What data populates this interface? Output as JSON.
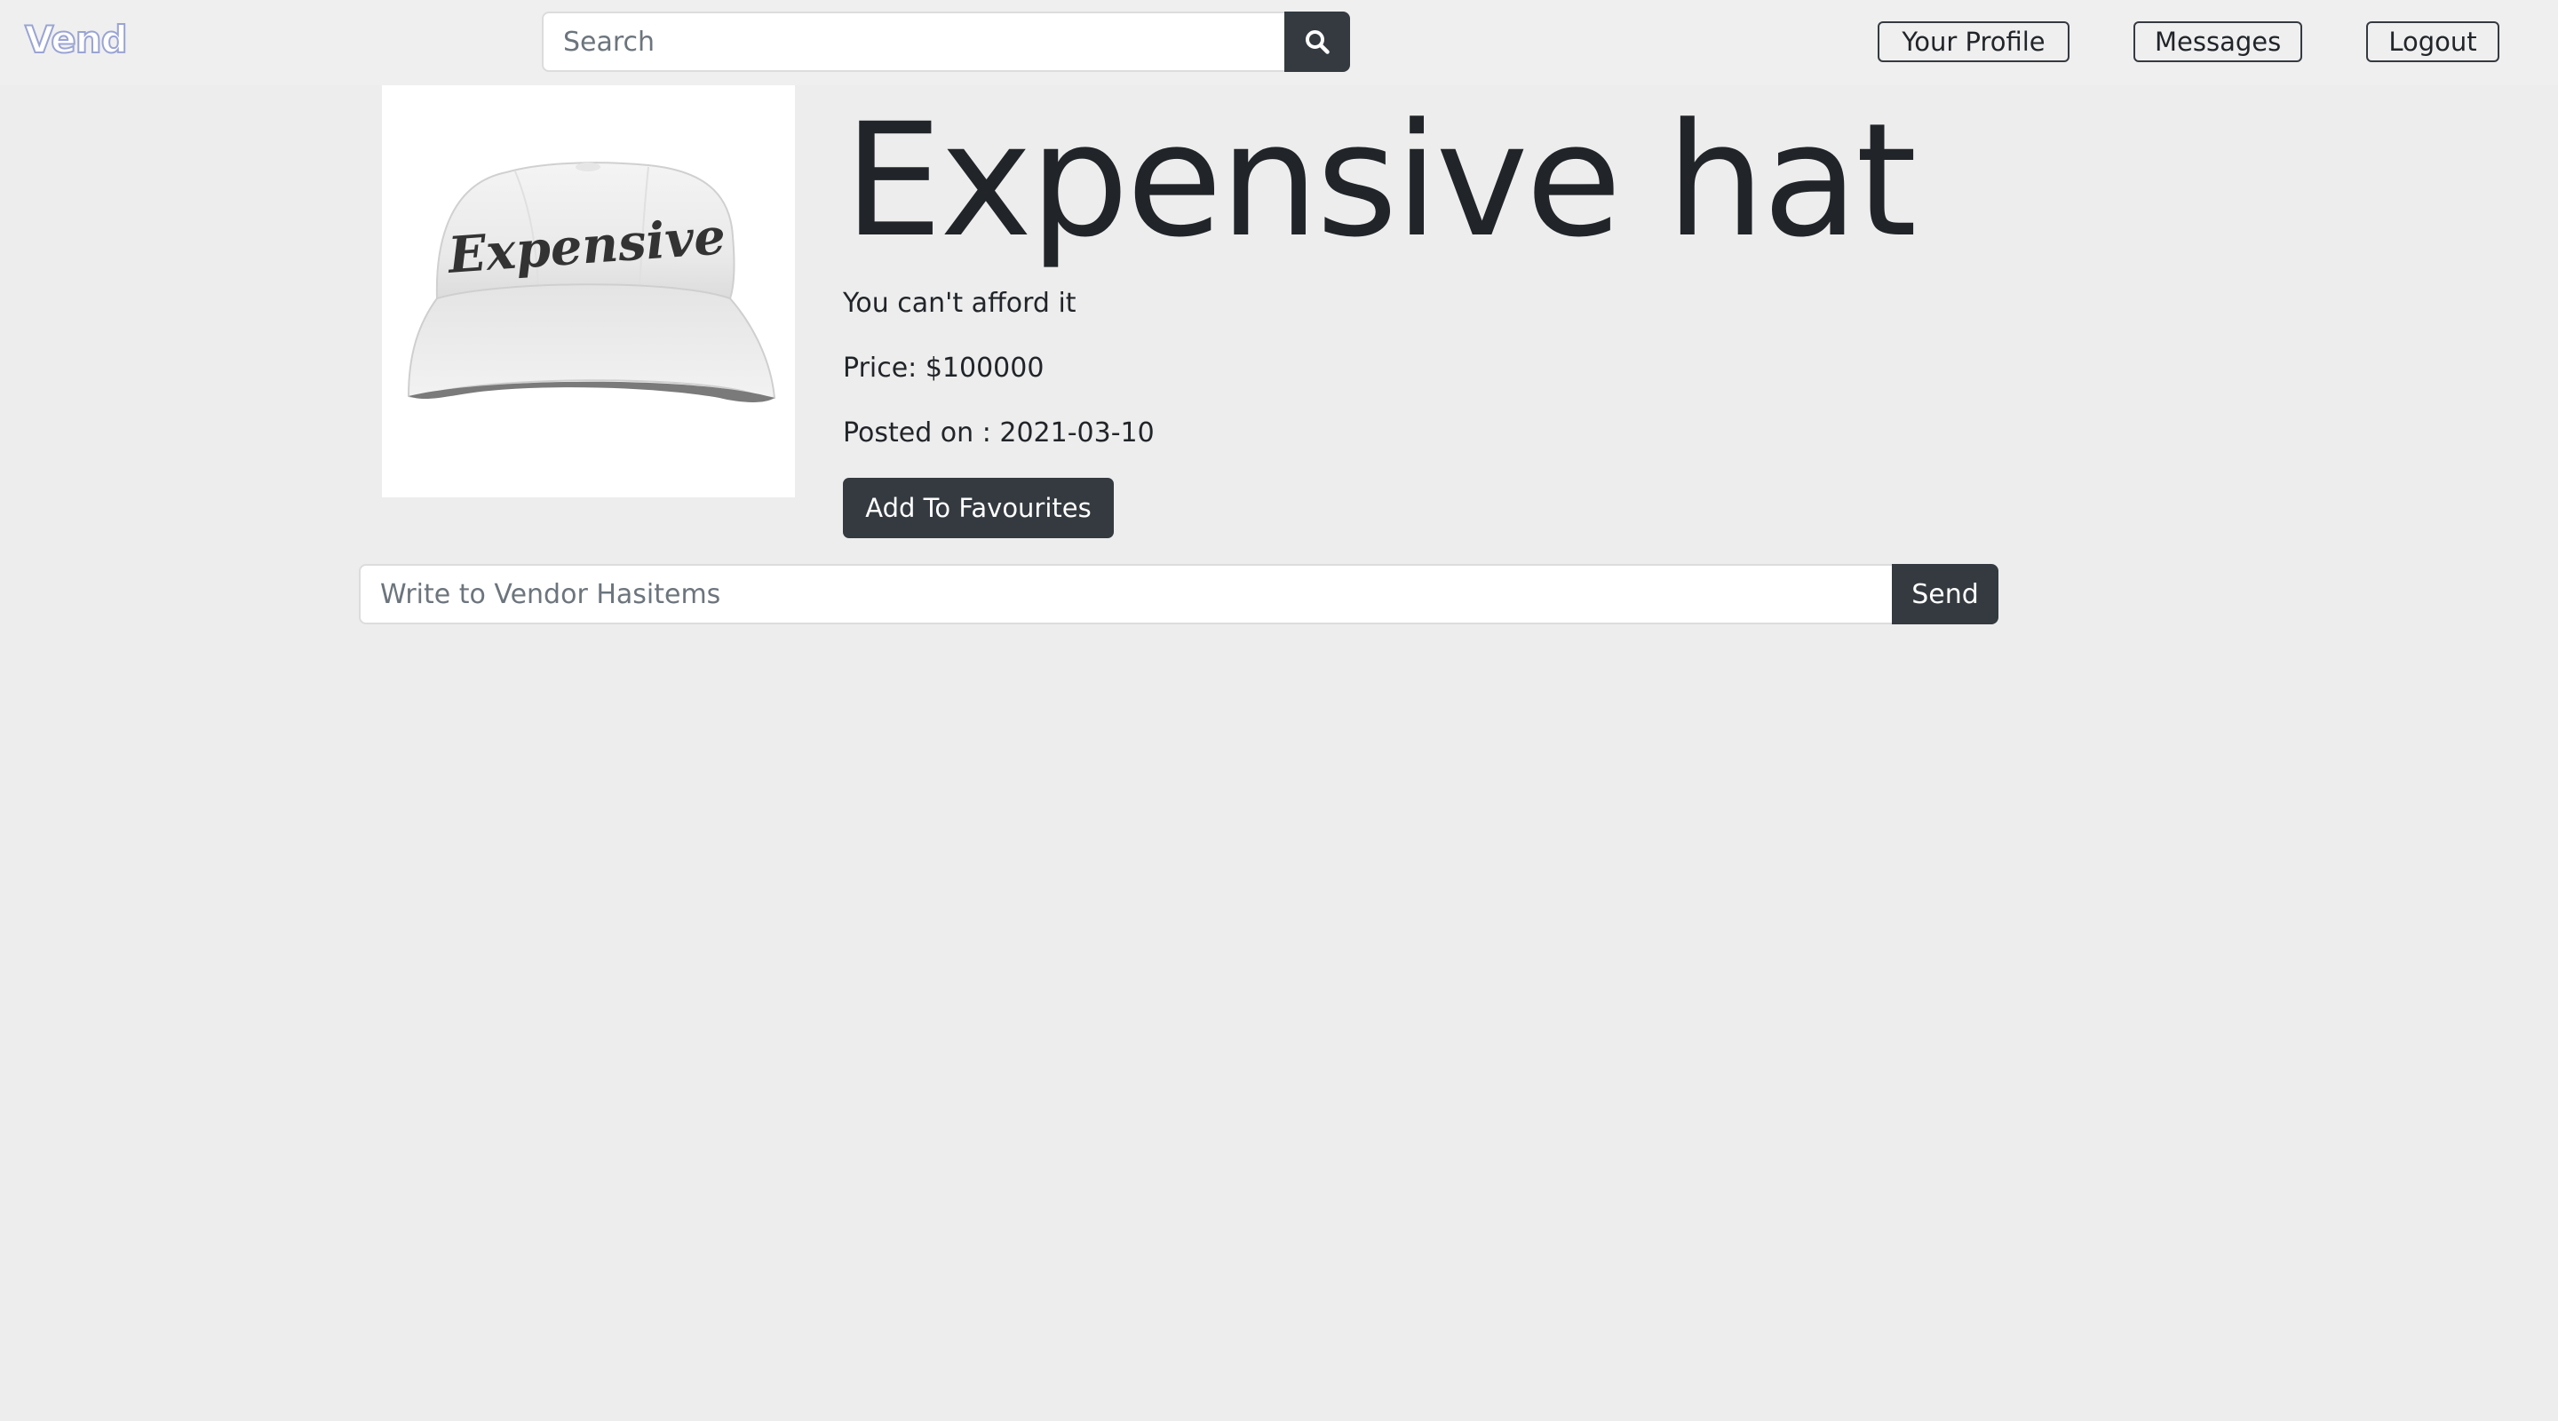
{
  "brand": "Vend",
  "search": {
    "placeholder": "Search",
    "value": "",
    "button_icon": "search-icon"
  },
  "nav": {
    "profile_label": "Your Profile",
    "messages_label": "Messages",
    "logout_label": "Logout"
  },
  "product": {
    "title": "Expensive hat",
    "description": "You can't afford it",
    "price_text": "Price: $100000",
    "posted_text": "Posted on : 2021-03-10",
    "image_alt": "white cap embroidered with the word Expensive",
    "image_text": "Expensive",
    "favourite_label": "Add To Favourites"
  },
  "vendor_message": {
    "placeholder": "Write to Vendor Hasitems",
    "value": "",
    "send_label": "Send"
  },
  "colors": {
    "page_bg": "#ededed",
    "dark_button": "#343a40",
    "brand_outline": "#9aa4d4"
  }
}
